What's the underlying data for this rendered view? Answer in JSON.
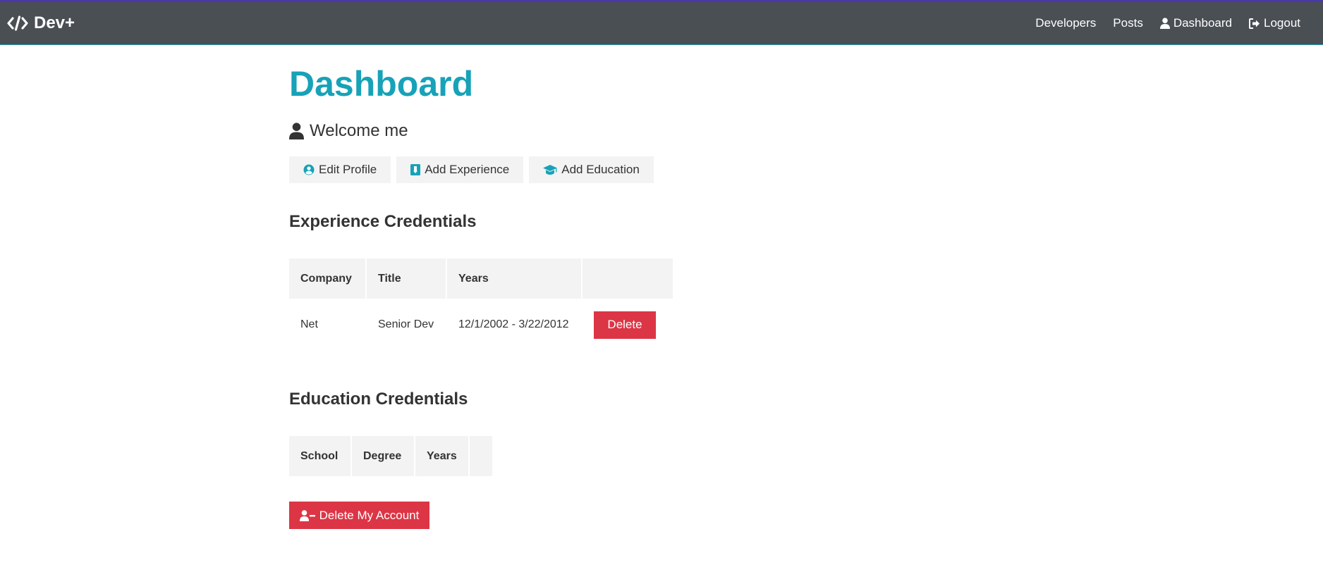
{
  "navbar": {
    "brand": "Dev+",
    "links": [
      {
        "label": "Developers",
        "icon": ""
      },
      {
        "label": "Posts",
        "icon": ""
      },
      {
        "label": "Dashboard",
        "icon": "user-icon"
      },
      {
        "label": "Logout",
        "icon": "logout-icon"
      }
    ]
  },
  "main": {
    "title": "Dashboard",
    "welcome": "Welcome me",
    "actions": {
      "edit_profile": "Edit Profile",
      "add_experience": "Add Experience",
      "add_education": "Add Education"
    }
  },
  "experience": {
    "title": "Experience Credentials",
    "columns": [
      "Company",
      "Title",
      "Years",
      ""
    ],
    "rows": [
      {
        "company": "Net",
        "title": "Senior Dev",
        "years": "12/1/2002 - 3/22/2012",
        "action": "Delete"
      }
    ]
  },
  "education": {
    "title": "Education Credentials",
    "columns": [
      "School",
      "Degree",
      "Years",
      ""
    ],
    "rows": []
  },
  "delete_account": "Delete My Account",
  "colors": {
    "navbar": "#4a4f54",
    "accent": "#17a2b8",
    "danger": "#dc3545",
    "light": "#f3f3f3"
  }
}
